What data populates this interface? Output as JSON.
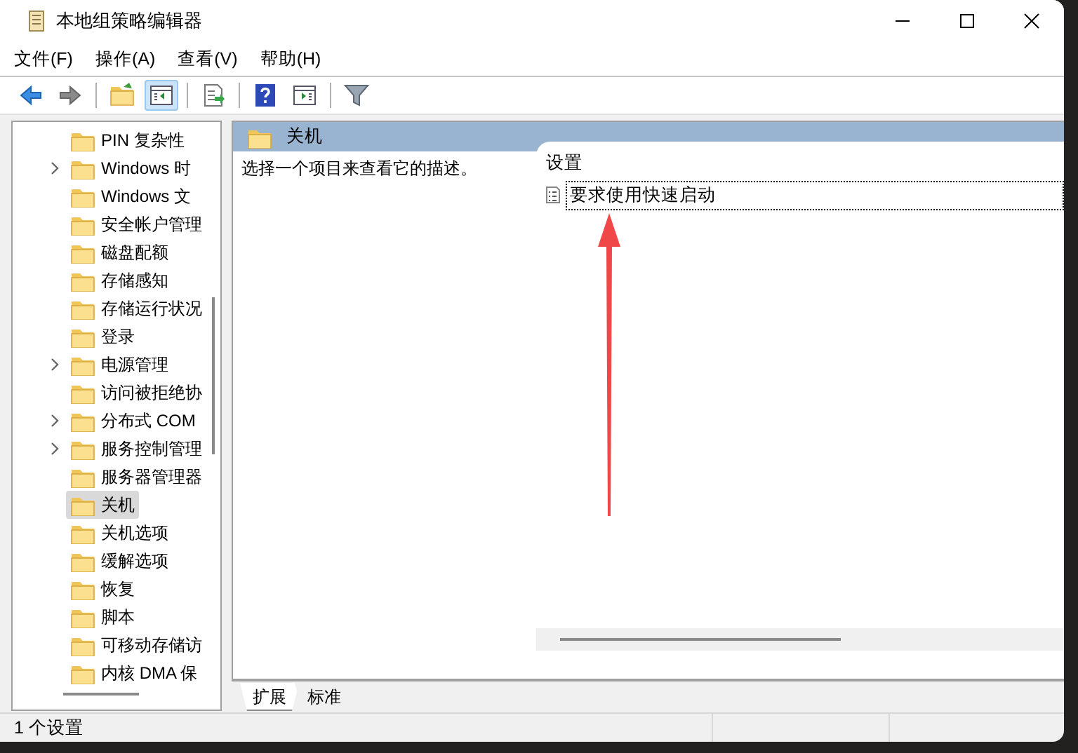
{
  "window": {
    "title": "本地组策略编辑器"
  },
  "menu": [
    "文件(F)",
    "操作(A)",
    "查看(V)",
    "帮助(H)"
  ],
  "toolbar": [
    {
      "kind": "back",
      "selected": false
    },
    {
      "kind": "forward",
      "selected": false
    },
    {
      "kind": "sep"
    },
    {
      "kind": "up",
      "selected": false
    },
    {
      "kind": "panel",
      "selected": true
    },
    {
      "kind": "sep"
    },
    {
      "kind": "export",
      "selected": false
    },
    {
      "kind": "sep"
    },
    {
      "kind": "help",
      "selected": false
    },
    {
      "kind": "panel2",
      "selected": false
    },
    {
      "kind": "sep"
    },
    {
      "kind": "filter",
      "selected": false
    }
  ],
  "tree": [
    {
      "label": "PIN 复杂性",
      "expandable": false,
      "selected": false
    },
    {
      "label": "Windows 时",
      "expandable": true,
      "selected": false
    },
    {
      "label": "Windows 文",
      "expandable": false,
      "selected": false
    },
    {
      "label": "安全帐户管理",
      "expandable": false,
      "selected": false
    },
    {
      "label": "磁盘配额",
      "expandable": false,
      "selected": false
    },
    {
      "label": "存储感知",
      "expandable": false,
      "selected": false
    },
    {
      "label": "存储运行状况",
      "expandable": false,
      "selected": false
    },
    {
      "label": "登录",
      "expandable": false,
      "selected": false
    },
    {
      "label": "电源管理",
      "expandable": true,
      "selected": false
    },
    {
      "label": "访问被拒绝协",
      "expandable": false,
      "selected": false
    },
    {
      "label": "分布式 COM",
      "expandable": true,
      "selected": false
    },
    {
      "label": "服务控制管理",
      "expandable": true,
      "selected": false
    },
    {
      "label": "服务器管理器",
      "expandable": false,
      "selected": false
    },
    {
      "label": "关机",
      "expandable": false,
      "selected": true
    },
    {
      "label": "关机选项",
      "expandable": false,
      "selected": false
    },
    {
      "label": "缓解选项",
      "expandable": false,
      "selected": false
    },
    {
      "label": "恢复",
      "expandable": false,
      "selected": false
    },
    {
      "label": "脚本",
      "expandable": false,
      "selected": false
    },
    {
      "label": "可移动存储访",
      "expandable": false,
      "selected": false
    },
    {
      "label": "内核 DMA 保",
      "expandable": false,
      "selected": false
    }
  ],
  "details": {
    "header": "关机",
    "description": "选择一个项目来查看它的描述。",
    "column": "设置",
    "settings": [
      {
        "label": "要求使用快速启动",
        "selected": true
      }
    ]
  },
  "tabs": [
    {
      "label": "扩展",
      "selected": true
    },
    {
      "label": "标准",
      "selected": false
    }
  ],
  "status_bar": "1 个设置"
}
